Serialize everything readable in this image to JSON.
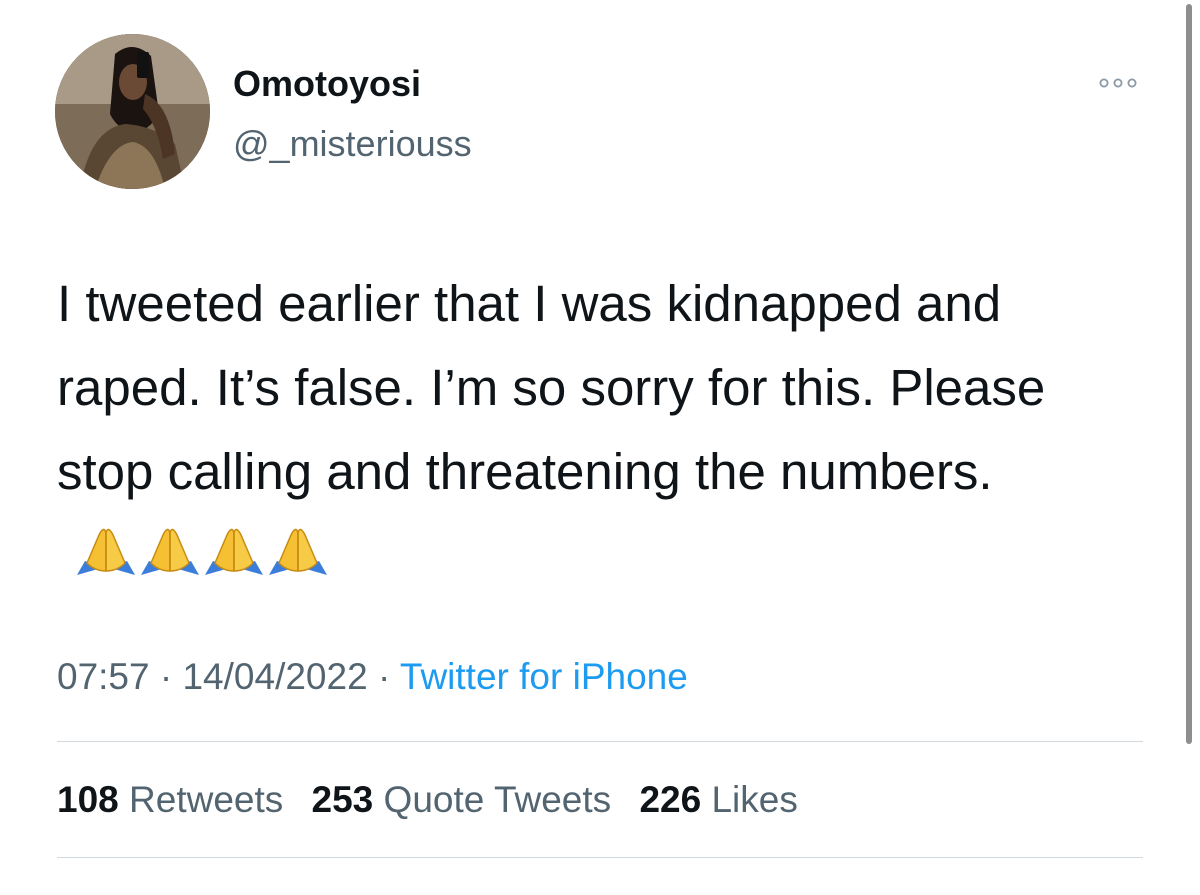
{
  "tweet": {
    "author": {
      "display_name": "Omotoyosi",
      "handle": "@_misteriouss"
    },
    "text": "I tweeted earlier that I was kidnapped and raped. It’s false. I’m so sorry for this. Please stop calling and threatening the numbers.",
    "emoji_icons": [
      "folded-hands-emoji",
      "folded-hands-emoji",
      "folded-hands-emoji",
      "folded-hands-emoji"
    ],
    "time": "07:57",
    "date": "14/04/2022",
    "separator": "·",
    "source": "Twitter for iPhone",
    "stats": {
      "retweets_count": "108",
      "retweets_label": "Retweets",
      "quotes_count": "253",
      "quotes_label": "Quote Tweets",
      "likes_count": "226",
      "likes_label": "Likes"
    }
  },
  "icons": {
    "more": "more-horizontal-icon"
  },
  "colors": {
    "text": "#0f1419",
    "secondary": "#536471",
    "link": "#1d9bf0",
    "divider": "#cfd9de"
  }
}
